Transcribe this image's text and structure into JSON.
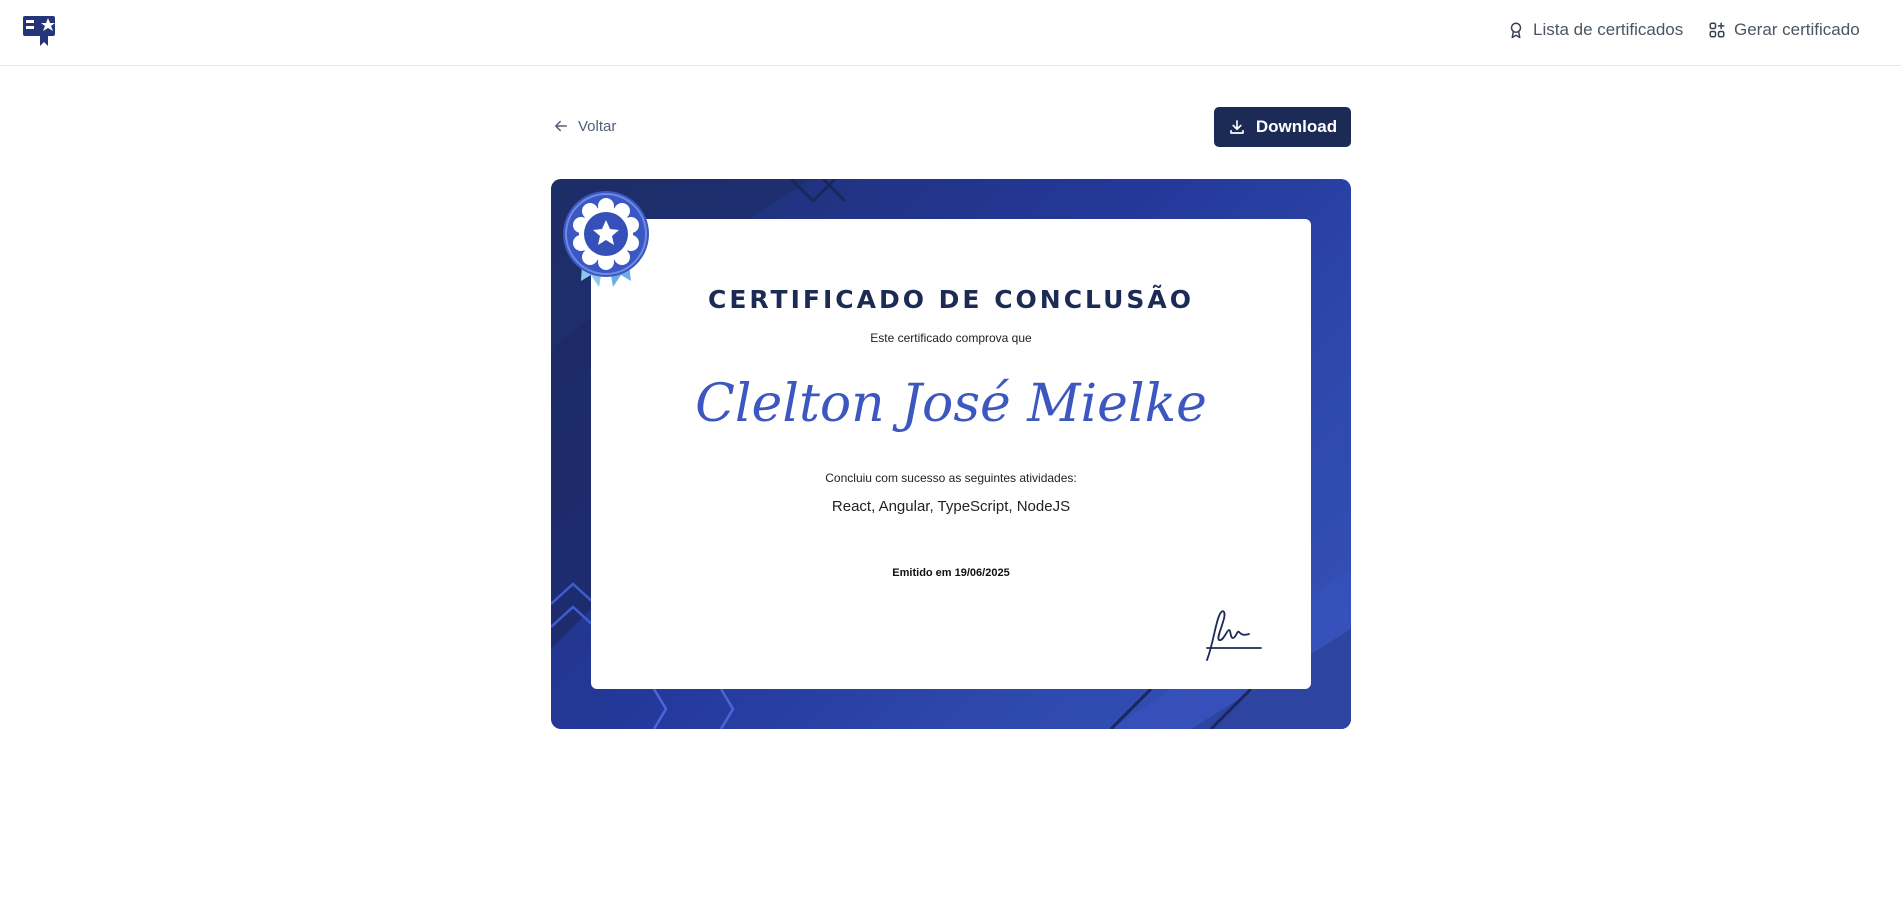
{
  "header": {
    "logo_icon": "certificate-badge-icon",
    "nav": [
      {
        "label": "Lista de certificados",
        "icon": "award-icon"
      },
      {
        "label": "Gerar certificado",
        "icon": "grid-plus-icon"
      }
    ]
  },
  "toolbar": {
    "back_label": "Voltar",
    "back_icon": "arrow-left-icon",
    "download_label": "Download",
    "download_icon": "download-icon"
  },
  "certificate": {
    "title": "CERTIFICADO DE CONCLUSÃO",
    "subtitle": "Este certificado comprova que",
    "recipient_name": "Clelton José Mielke",
    "completed_text": "Concluiu com sucesso as seguintes atividades:",
    "activities": "React, Angular, TypeScript, NodeJS",
    "issued_text": "Emitido em 19/06/2025",
    "seal_icon": "star-rosette-icon",
    "signature_icon": "signature-icon"
  },
  "colors": {
    "brand_dark": "#1c2a56",
    "frame_blue": "#2f4aae",
    "name_blue": "#3d57c0",
    "ribbon_light": "#8ec6ee"
  }
}
